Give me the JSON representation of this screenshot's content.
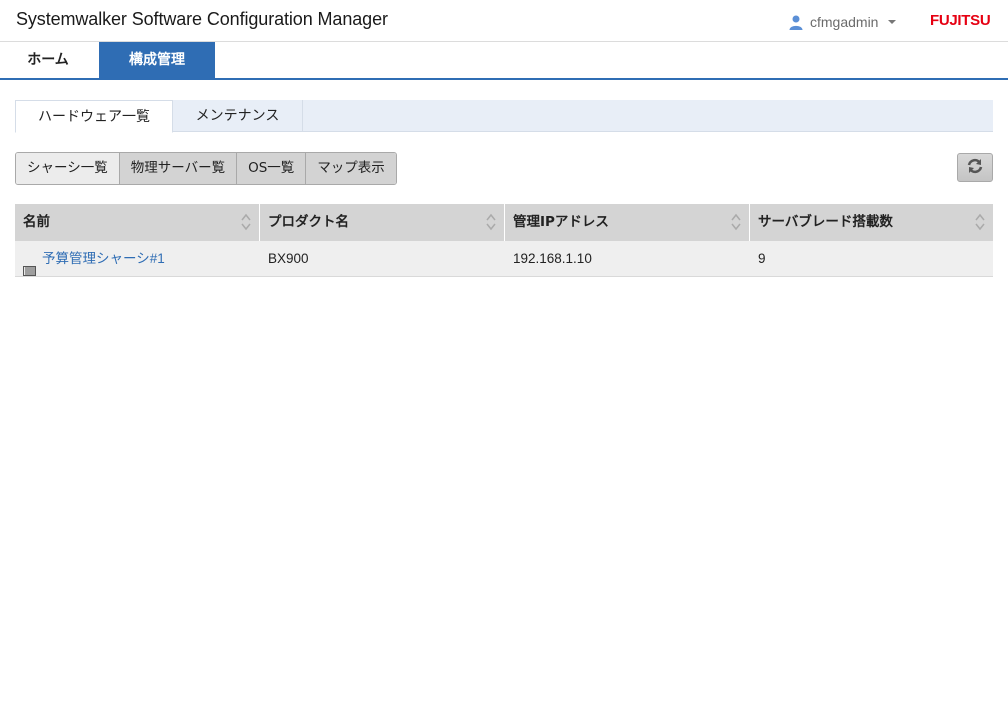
{
  "header": {
    "title": "Systemwalker Software Configuration Manager",
    "user": "cfmgadmin",
    "brand": "FUJITSU"
  },
  "main_nav": {
    "tabs": [
      {
        "label": "ホーム",
        "active": false
      },
      {
        "label": "構成管理",
        "active": true
      }
    ]
  },
  "sub_tabs": [
    {
      "label": "ハードウェア一覧",
      "active": true
    },
    {
      "label": "メンテナンス",
      "active": false
    }
  ],
  "view_buttons": [
    {
      "label": "シャーシ一覧",
      "active": true
    },
    {
      "label": "物理サーバー覧",
      "active": false
    },
    {
      "label": "OS一覧",
      "active": false
    },
    {
      "label": "マップ表示",
      "active": false
    }
  ],
  "table": {
    "columns": [
      "名前",
      "プロダクト名",
      "管理IPアドレス",
      "サーバブレード搭載数"
    ],
    "rows": [
      {
        "name": "予算管理シャーシ#1",
        "product": "BX900",
        "ip": "192.168.1.10",
        "blades": "9"
      }
    ]
  },
  "colors": {
    "accent": "#2f6db4",
    "brand": "#e60012",
    "link": "#2f6db4"
  }
}
